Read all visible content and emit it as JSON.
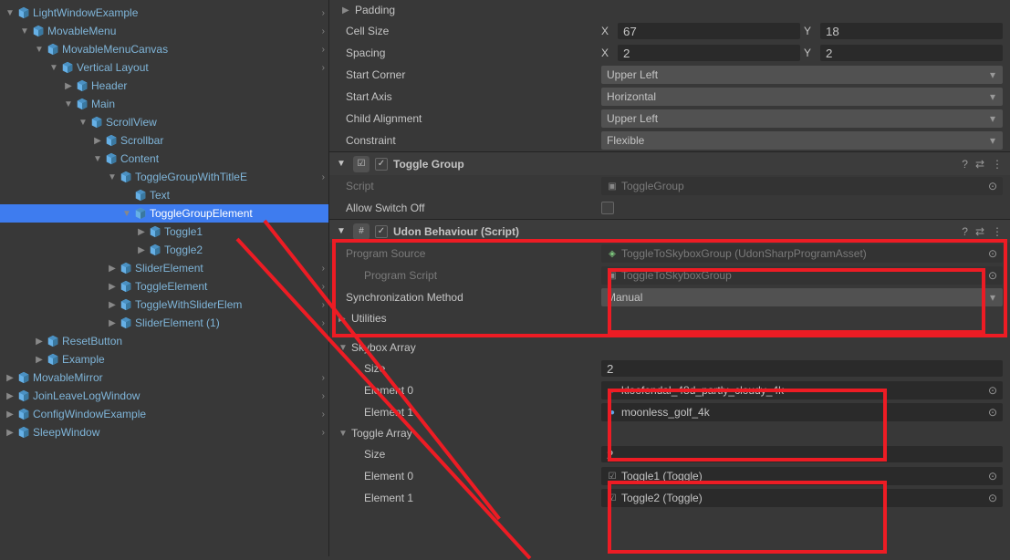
{
  "hierarchy": {
    "items": [
      {
        "depth": 0,
        "fold": "open",
        "label": "LightWindowExample",
        "chev": true
      },
      {
        "depth": 1,
        "fold": "open",
        "label": "MovableMenu",
        "chev": true
      },
      {
        "depth": 2,
        "fold": "open",
        "label": "MovableMenuCanvas",
        "chev": true
      },
      {
        "depth": 3,
        "fold": "open",
        "label": "Vertical Layout",
        "chev": true
      },
      {
        "depth": 4,
        "fold": "closed",
        "label": "Header",
        "chev": false
      },
      {
        "depth": 4,
        "fold": "open",
        "label": "Main",
        "chev": false
      },
      {
        "depth": 5,
        "fold": "open",
        "label": "ScrollView",
        "chev": false
      },
      {
        "depth": 6,
        "fold": "closed",
        "label": "Scrollbar",
        "chev": false
      },
      {
        "depth": 6,
        "fold": "open",
        "label": "Content",
        "chev": false
      },
      {
        "depth": 7,
        "fold": "open",
        "label": "ToggleGroupWithTitleE",
        "chev": true,
        "clip": true
      },
      {
        "depth": 8,
        "fold": "none",
        "label": "Text",
        "chev": false
      },
      {
        "depth": 8,
        "fold": "open",
        "label": "ToggleGroupElement",
        "chev": false,
        "selected": true
      },
      {
        "depth": 9,
        "fold": "closed",
        "label": "Toggle1",
        "chev": false
      },
      {
        "depth": 9,
        "fold": "closed",
        "label": "Toggle2",
        "chev": false
      },
      {
        "depth": 7,
        "fold": "closed",
        "label": "SliderElement",
        "chev": true
      },
      {
        "depth": 7,
        "fold": "closed",
        "label": "ToggleElement",
        "chev": true
      },
      {
        "depth": 7,
        "fold": "closed",
        "label": "ToggleWithSliderElem",
        "chev": true,
        "clip": true
      },
      {
        "depth": 7,
        "fold": "closed",
        "label": "SliderElement (1)",
        "chev": true
      },
      {
        "depth": 2,
        "fold": "closed",
        "label": "ResetButton",
        "chev": false
      },
      {
        "depth": 2,
        "fold": "closed",
        "label": "Example",
        "chev": false
      },
      {
        "depth": 0,
        "fold": "closed",
        "label": "MovableMirror",
        "chev": true
      },
      {
        "depth": 0,
        "fold": "closed",
        "label": "JoinLeaveLogWindow",
        "chev": true
      },
      {
        "depth": 0,
        "fold": "closed",
        "label": "ConfigWindowExample",
        "chev": true
      },
      {
        "depth": 0,
        "fold": "closed",
        "label": "SleepWindow",
        "chev": true
      }
    ]
  },
  "inspector": {
    "grid": {
      "padding_fold_label": "Padding",
      "cellsize_label": "Cell Size",
      "cellsize_x": "67",
      "cellsize_y": "18",
      "spacing_label": "Spacing",
      "spacing_x": "2",
      "spacing_y": "2",
      "startcorner_label": "Start Corner",
      "startcorner_val": "Upper Left",
      "startaxis_label": "Start Axis",
      "startaxis_val": "Horizontal",
      "childalign_label": "Child Alignment",
      "childalign_val": "Upper Left",
      "constraint_label": "Constraint",
      "constraint_val": "Flexible"
    },
    "togglegroup": {
      "title": "Toggle Group",
      "script_label": "Script",
      "script_val": "ToggleGroup",
      "allowswitchoff_label": "Allow Switch Off"
    },
    "udon": {
      "title": "Udon Behaviour (Script)",
      "progsrc_label": "Program Source",
      "progsrc_val": "ToggleToSkyboxGroup (UdonSharpProgramAsset)",
      "progscript_label": "Program Script",
      "progscript_val": "ToggleToSkyboxGroup",
      "sync_label": "Synchronization Method",
      "sync_val": "Manual",
      "utilities_label": "Utilities",
      "skybox_array_label": "Skybox Array",
      "skybox_size_label": "Size",
      "skybox_size": "2",
      "skybox_e0_label": "Element 0",
      "skybox_e0": "kloofendal_48d_partly_cloudy_4k",
      "skybox_e1_label": "Element 1",
      "skybox_e1": "moonless_golf_4k",
      "toggle_array_label": "Toggle Array",
      "toggle_size_label": "Size",
      "toggle_size": "2",
      "toggle_e0_label": "Element 0",
      "toggle_e0": "Toggle1 (Toggle)",
      "toggle_e1_label": "Element 1",
      "toggle_e1": "Toggle2 (Toggle)"
    },
    "xy_x": "X",
    "xy_y": "Y"
  }
}
